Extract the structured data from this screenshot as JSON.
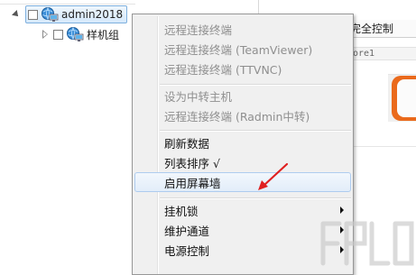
{
  "tree": {
    "root": {
      "label": "admin2018"
    },
    "child": {
      "label": "样机组"
    }
  },
  "right_panel": {
    "column_header": "完全控制",
    "sub_text": "ore1"
  },
  "context_menu": {
    "items": [
      {
        "label": "远程连接终端",
        "enabled": false
      },
      {
        "label": "远程连接终端 (TeamViewer)",
        "enabled": false
      },
      {
        "label": "远程连接终端 (TTVNC)",
        "enabled": false
      },
      {
        "label": "设为中转主机",
        "enabled": false
      },
      {
        "label": "远程连接终端 (Radmin中转)",
        "enabled": false
      },
      {
        "label": "刷新数据",
        "enabled": true
      },
      {
        "label": "列表排序 √",
        "enabled": true
      },
      {
        "label": "启用屏幕墙",
        "enabled": true,
        "highlighted": true
      },
      {
        "label": "挂机锁",
        "enabled": true,
        "submenu": true
      },
      {
        "label": "维护通道",
        "enabled": true,
        "submenu": true
      },
      {
        "label": "电源控制",
        "enabled": true,
        "submenu": true
      }
    ]
  },
  "colors": {
    "annotation_arrow": "#e02020",
    "remote_bar_accent": "#ea6a1c",
    "menu_background": "#f0f0f0",
    "menu_highlight_border": "#aeccef"
  }
}
